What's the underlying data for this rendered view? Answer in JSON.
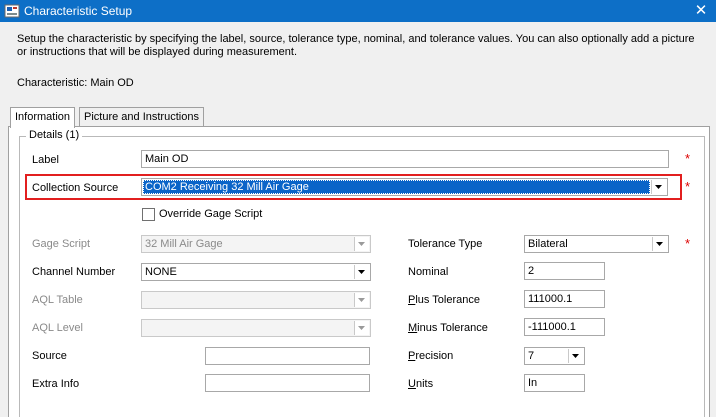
{
  "window": {
    "title": "Characteristic Setup",
    "close_label": "✕"
  },
  "intro_text": "Setup the characteristic by specifying the label, source, tolerance type, nominal, and tolerance values. You can also optionally add a picture or instructions that will be displayed during measurement.",
  "characteristic_line": "Characteristic: Main OD",
  "tabs": [
    {
      "label": "Information",
      "active": true
    },
    {
      "label": "Picture and Instructions",
      "active": false
    }
  ],
  "details": {
    "group_title": "Details (1)",
    "required_mark": "*",
    "label": {
      "label": "Label",
      "value": "Main OD"
    },
    "collection_source": {
      "label": "Collection Source",
      "value": "COM2 Receiving 32 Mill Air Gage"
    },
    "override_gage_script": {
      "label": "Override Gage Script",
      "checked": false
    },
    "gage_script": {
      "label": "Gage Script",
      "value": "32 Mill Air Gage"
    },
    "channel_number": {
      "label": "Channel Number",
      "value": "NONE"
    },
    "aql_table": {
      "label": "AQL Table",
      "value": ""
    },
    "aql_level": {
      "label": "AQL Level",
      "value": ""
    },
    "source": {
      "label": "Source",
      "value": ""
    },
    "extra_info": {
      "label": "Extra Info",
      "value": ""
    },
    "tolerance_type": {
      "label": "Tolerance Type",
      "value": "Bilateral"
    },
    "nominal": {
      "label": "Nominal",
      "value": "2"
    },
    "plus_tolerance": {
      "label_accel": "P",
      "label_rest": "lus Tolerance",
      "value": "111000.1"
    },
    "minus_tolerance": {
      "label_accel": "M",
      "label_rest": "inus Tolerance",
      "value": "-111000.1"
    },
    "precision": {
      "label_accel": "P",
      "label_rest": "recision",
      "value": "7"
    },
    "units": {
      "label_accel": "U",
      "label_rest": "nits",
      "value": "In"
    }
  },
  "colors": {
    "titlebar": "#0d6fc7",
    "highlight_border": "#e21f1f",
    "selection": "#0a64c8",
    "required": "#dd0000"
  }
}
